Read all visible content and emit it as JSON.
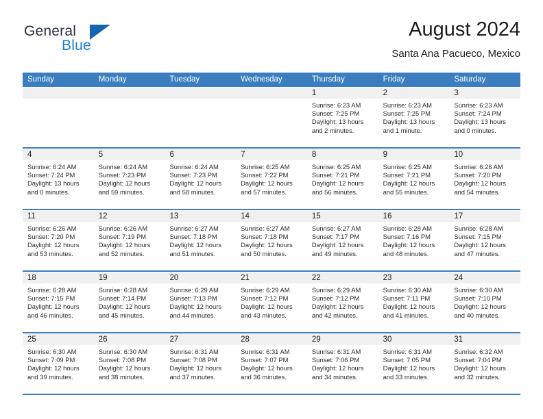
{
  "brand": {
    "name_top": "General",
    "name_bottom": "Blue",
    "triangle_color": "#1565b0",
    "blue_text_color": "#1b7fd4"
  },
  "header": {
    "title": "August 2024",
    "location": "Santa Ana Pacueco, Mexico"
  },
  "theme": {
    "header_blue": "#3a7ec0",
    "day_band_gray": "#f0f0f0",
    "text_color": "#1c1c1c"
  },
  "weekdays": [
    "Sunday",
    "Monday",
    "Tuesday",
    "Wednesday",
    "Thursday",
    "Friday",
    "Saturday"
  ],
  "labels": {
    "sunrise_prefix": "Sunrise:",
    "sunset_prefix": "Sunset:",
    "daylight_prefix": "Daylight:"
  },
  "weeks": [
    [
      {
        "day": "",
        "sunrise": "",
        "sunset": "",
        "daylight_line1": "",
        "daylight_line2": ""
      },
      {
        "day": "",
        "sunrise": "",
        "sunset": "",
        "daylight_line1": "",
        "daylight_line2": ""
      },
      {
        "day": "",
        "sunrise": "",
        "sunset": "",
        "daylight_line1": "",
        "daylight_line2": ""
      },
      {
        "day": "",
        "sunrise": "",
        "sunset": "",
        "daylight_line1": "",
        "daylight_line2": ""
      },
      {
        "day": "1",
        "sunrise": "Sunrise: 6:23 AM",
        "sunset": "Sunset: 7:25 PM",
        "daylight_line1": "Daylight: 13 hours",
        "daylight_line2": "and 2 minutes."
      },
      {
        "day": "2",
        "sunrise": "Sunrise: 6:23 AM",
        "sunset": "Sunset: 7:25 PM",
        "daylight_line1": "Daylight: 13 hours",
        "daylight_line2": "and 1 minute."
      },
      {
        "day": "3",
        "sunrise": "Sunrise: 6:23 AM",
        "sunset": "Sunset: 7:24 PM",
        "daylight_line1": "Daylight: 13 hours",
        "daylight_line2": "and 0 minutes."
      }
    ],
    [
      {
        "day": "4",
        "sunrise": "Sunrise: 6:24 AM",
        "sunset": "Sunset: 7:24 PM",
        "daylight_line1": "Daylight: 13 hours",
        "daylight_line2": "and 0 minutes."
      },
      {
        "day": "5",
        "sunrise": "Sunrise: 6:24 AM",
        "sunset": "Sunset: 7:23 PM",
        "daylight_line1": "Daylight: 12 hours",
        "daylight_line2": "and 59 minutes."
      },
      {
        "day": "6",
        "sunrise": "Sunrise: 6:24 AM",
        "sunset": "Sunset: 7:23 PM",
        "daylight_line1": "Daylight: 12 hours",
        "daylight_line2": "and 58 minutes."
      },
      {
        "day": "7",
        "sunrise": "Sunrise: 6:25 AM",
        "sunset": "Sunset: 7:22 PM",
        "daylight_line1": "Daylight: 12 hours",
        "daylight_line2": "and 57 minutes."
      },
      {
        "day": "8",
        "sunrise": "Sunrise: 6:25 AM",
        "sunset": "Sunset: 7:21 PM",
        "daylight_line1": "Daylight: 12 hours",
        "daylight_line2": "and 56 minutes."
      },
      {
        "day": "9",
        "sunrise": "Sunrise: 6:25 AM",
        "sunset": "Sunset: 7:21 PM",
        "daylight_line1": "Daylight: 12 hours",
        "daylight_line2": "and 55 minutes."
      },
      {
        "day": "10",
        "sunrise": "Sunrise: 6:26 AM",
        "sunset": "Sunset: 7:20 PM",
        "daylight_line1": "Daylight: 12 hours",
        "daylight_line2": "and 54 minutes."
      }
    ],
    [
      {
        "day": "11",
        "sunrise": "Sunrise: 6:26 AM",
        "sunset": "Sunset: 7:20 PM",
        "daylight_line1": "Daylight: 12 hours",
        "daylight_line2": "and 53 minutes."
      },
      {
        "day": "12",
        "sunrise": "Sunrise: 6:26 AM",
        "sunset": "Sunset: 7:19 PM",
        "daylight_line1": "Daylight: 12 hours",
        "daylight_line2": "and 52 minutes."
      },
      {
        "day": "13",
        "sunrise": "Sunrise: 6:27 AM",
        "sunset": "Sunset: 7:18 PM",
        "daylight_line1": "Daylight: 12 hours",
        "daylight_line2": "and 51 minutes."
      },
      {
        "day": "14",
        "sunrise": "Sunrise: 6:27 AM",
        "sunset": "Sunset: 7:18 PM",
        "daylight_line1": "Daylight: 12 hours",
        "daylight_line2": "and 50 minutes."
      },
      {
        "day": "15",
        "sunrise": "Sunrise: 6:27 AM",
        "sunset": "Sunset: 7:17 PM",
        "daylight_line1": "Daylight: 12 hours",
        "daylight_line2": "and 49 minutes."
      },
      {
        "day": "16",
        "sunrise": "Sunrise: 6:28 AM",
        "sunset": "Sunset: 7:16 PM",
        "daylight_line1": "Daylight: 12 hours",
        "daylight_line2": "and 48 minutes."
      },
      {
        "day": "17",
        "sunrise": "Sunrise: 6:28 AM",
        "sunset": "Sunset: 7:15 PM",
        "daylight_line1": "Daylight: 12 hours",
        "daylight_line2": "and 47 minutes."
      }
    ],
    [
      {
        "day": "18",
        "sunrise": "Sunrise: 6:28 AM",
        "sunset": "Sunset: 7:15 PM",
        "daylight_line1": "Daylight: 12 hours",
        "daylight_line2": "and 46 minutes."
      },
      {
        "day": "19",
        "sunrise": "Sunrise: 6:28 AM",
        "sunset": "Sunset: 7:14 PM",
        "daylight_line1": "Daylight: 12 hours",
        "daylight_line2": "and 45 minutes."
      },
      {
        "day": "20",
        "sunrise": "Sunrise: 6:29 AM",
        "sunset": "Sunset: 7:13 PM",
        "daylight_line1": "Daylight: 12 hours",
        "daylight_line2": "and 44 minutes."
      },
      {
        "day": "21",
        "sunrise": "Sunrise: 6:29 AM",
        "sunset": "Sunset: 7:12 PM",
        "daylight_line1": "Daylight: 12 hours",
        "daylight_line2": "and 43 minutes."
      },
      {
        "day": "22",
        "sunrise": "Sunrise: 6:29 AM",
        "sunset": "Sunset: 7:12 PM",
        "daylight_line1": "Daylight: 12 hours",
        "daylight_line2": "and 42 minutes."
      },
      {
        "day": "23",
        "sunrise": "Sunrise: 6:30 AM",
        "sunset": "Sunset: 7:11 PM",
        "daylight_line1": "Daylight: 12 hours",
        "daylight_line2": "and 41 minutes."
      },
      {
        "day": "24",
        "sunrise": "Sunrise: 6:30 AM",
        "sunset": "Sunset: 7:10 PM",
        "daylight_line1": "Daylight: 12 hours",
        "daylight_line2": "and 40 minutes."
      }
    ],
    [
      {
        "day": "25",
        "sunrise": "Sunrise: 6:30 AM",
        "sunset": "Sunset: 7:09 PM",
        "daylight_line1": "Daylight: 12 hours",
        "daylight_line2": "and 39 minutes."
      },
      {
        "day": "26",
        "sunrise": "Sunrise: 6:30 AM",
        "sunset": "Sunset: 7:08 PM",
        "daylight_line1": "Daylight: 12 hours",
        "daylight_line2": "and 38 minutes."
      },
      {
        "day": "27",
        "sunrise": "Sunrise: 6:31 AM",
        "sunset": "Sunset: 7:08 PM",
        "daylight_line1": "Daylight: 12 hours",
        "daylight_line2": "and 37 minutes."
      },
      {
        "day": "28",
        "sunrise": "Sunrise: 6:31 AM",
        "sunset": "Sunset: 7:07 PM",
        "daylight_line1": "Daylight: 12 hours",
        "daylight_line2": "and 36 minutes."
      },
      {
        "day": "29",
        "sunrise": "Sunrise: 6:31 AM",
        "sunset": "Sunset: 7:06 PM",
        "daylight_line1": "Daylight: 12 hours",
        "daylight_line2": "and 34 minutes."
      },
      {
        "day": "30",
        "sunrise": "Sunrise: 6:31 AM",
        "sunset": "Sunset: 7:05 PM",
        "daylight_line1": "Daylight: 12 hours",
        "daylight_line2": "and 33 minutes."
      },
      {
        "day": "31",
        "sunrise": "Sunrise: 6:32 AM",
        "sunset": "Sunset: 7:04 PM",
        "daylight_line1": "Daylight: 12 hours",
        "daylight_line2": "and 32 minutes."
      }
    ]
  ]
}
